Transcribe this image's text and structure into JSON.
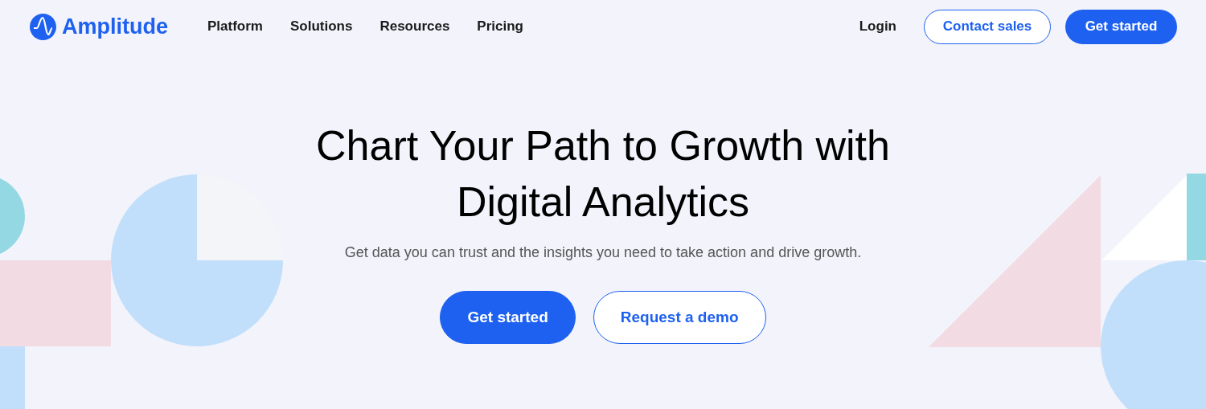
{
  "nav": {
    "logo": "Amplitude",
    "links": [
      "Platform",
      "Solutions",
      "Resources",
      "Pricing"
    ],
    "login": "Login",
    "contact": "Contact sales",
    "cta": "Get started"
  },
  "hero": {
    "title_lines": [
      "Chart Your Path to Growth with",
      "Digital Analytics"
    ],
    "subtitle": "Get data you can trust and the insights you need to take action and drive growth.",
    "buttons": [
      {
        "label": "Get started",
        "kind": "primary"
      },
      {
        "label": "Request a demo",
        "kind": "outline"
      }
    ]
  }
}
